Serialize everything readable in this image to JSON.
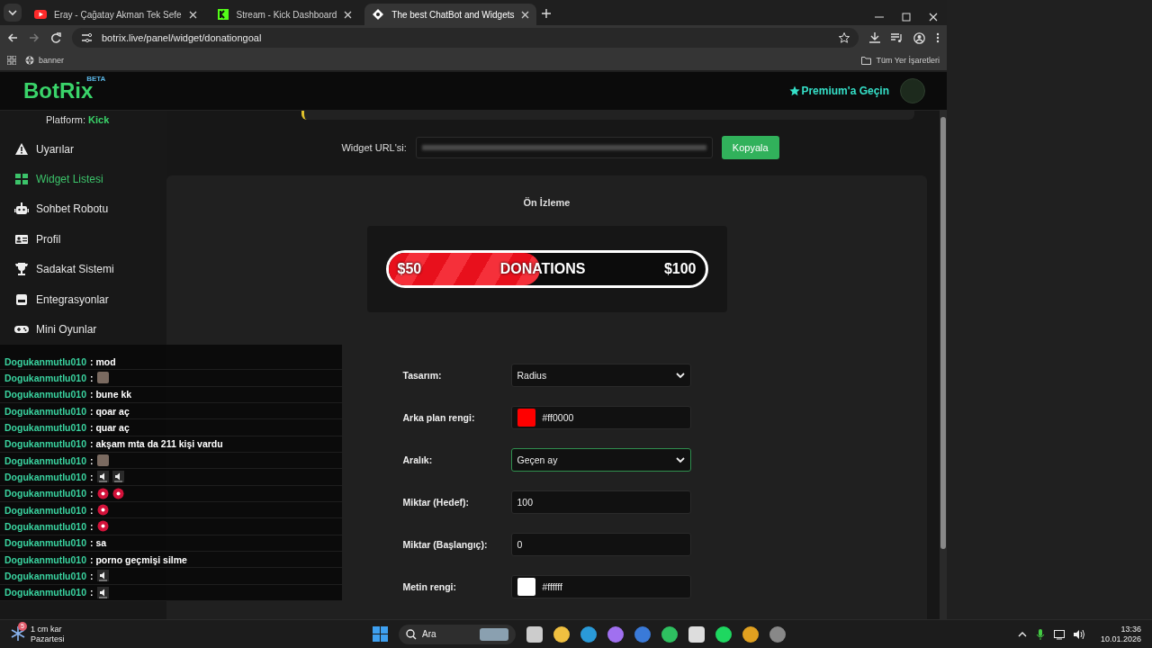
{
  "browser": {
    "tabs": [
      {
        "title": "Eray - Çağatay Akman Tek Sefe",
        "selected": false
      },
      {
        "title": "Stream - Kick Dashboard",
        "selected": false
      },
      {
        "title": "The best ChatBot and Widgets",
        "selected": true
      }
    ],
    "url": "botrix.live/panel/widget/donationgoal",
    "bookmark": "banner",
    "all_bookmarks": "Tüm Yer İşaretleri"
  },
  "header": {
    "logo": "BotRix",
    "logo_badge": "BETA",
    "premium": "Premium'a Geçin"
  },
  "sidebar": {
    "platform_label": "Platform:",
    "platform": "Kick",
    "items": [
      {
        "label": "Uyarılar",
        "selected": false
      },
      {
        "label": "Widget Listesi",
        "selected": true
      },
      {
        "label": "Sohbet Robotu",
        "selected": false
      },
      {
        "label": "Profil",
        "selected": false
      },
      {
        "label": "Sadakat Sistemi",
        "selected": false
      },
      {
        "label": "Entegrasyonlar",
        "selected": false
      },
      {
        "label": "Mini Oyunlar",
        "selected": false
      }
    ]
  },
  "widget_url": {
    "label": "Widget URL'si:",
    "button": "Kopyala"
  },
  "preview": {
    "title": "Ön İzleme",
    "start": "$50",
    "label": "DONATIONS",
    "goal": "$100",
    "level": 0.48
  },
  "settings": [
    {
      "kind": "select",
      "label": "Tasarım:",
      "value": "Radius",
      "focused": false
    },
    {
      "kind": "color",
      "label": "Arka plan rengi:",
      "value": "#ff0000",
      "color": "#ff0000",
      "focused": false
    },
    {
      "kind": "select",
      "label": "Aralık:",
      "value": "Geçen ay",
      "focused": true
    },
    {
      "kind": "input",
      "label": "Miktar (Hedef):",
      "value": "100",
      "focused": false
    },
    {
      "kind": "input",
      "label": "Miktar (Başlangıç):",
      "value": "0",
      "focused": false
    },
    {
      "kind": "color",
      "label": "Metin rengi:",
      "value": "#ffffff",
      "color": "#ffffff",
      "focused": false
    }
  ],
  "chat": [
    {
      "user": "Dogukanmutlu010",
      "message": ": mod"
    },
    {
      "user": "Dogukanmutlu010",
      "message": ":",
      "emotes": [
        {
          "kind": "photo"
        }
      ]
    },
    {
      "user": "Dogukanmutlu010",
      "message": ": bune kk"
    },
    {
      "user": "Dogukanmutlu010",
      "message": ": qoar aç"
    },
    {
      "user": "Dogukanmutlu010",
      "message": ": quar aç"
    },
    {
      "user": "Dogukanmutlu010",
      "message": ": akşam mta da 211 kişi vardu"
    },
    {
      "user": "Dogukanmutlu010",
      "message": ":",
      "emotes": [
        {
          "kind": "photo"
        }
      ]
    },
    {
      "user": "Dogukanmutlu010",
      "message": ":",
      "emotes": [
        {
          "kind": "speaker"
        },
        {
          "kind": "speaker"
        }
      ]
    },
    {
      "user": "Dogukanmutlu010",
      "message": ":",
      "emotes": [
        {
          "kind": "dot"
        },
        {
          "kind": "dot"
        }
      ]
    },
    {
      "user": "Dogukanmutlu010",
      "message": ":",
      "emotes": [
        {
          "kind": "dot"
        }
      ]
    },
    {
      "user": "Dogukanmutlu010",
      "message": ":",
      "emotes": [
        {
          "kind": "dot"
        }
      ]
    },
    {
      "user": "Dogukanmutlu010",
      "message": ": sa"
    },
    {
      "user": "Dogukanmutlu010",
      "message": ": porno geçmişi silme"
    },
    {
      "user": "Dogukanmutlu010",
      "message": ":",
      "emotes": [
        {
          "kind": "speaker"
        }
      ]
    },
    {
      "user": "Dogukanmutlu010",
      "message": ":",
      "emotes": [
        {
          "kind": "speaker"
        }
      ]
    }
  ],
  "taskbar": {
    "weather": "1 cm kar",
    "day": "Pazartesi",
    "badge": "5",
    "search": "Ara",
    "time": "13:36",
    "date": "10.01.2026"
  }
}
